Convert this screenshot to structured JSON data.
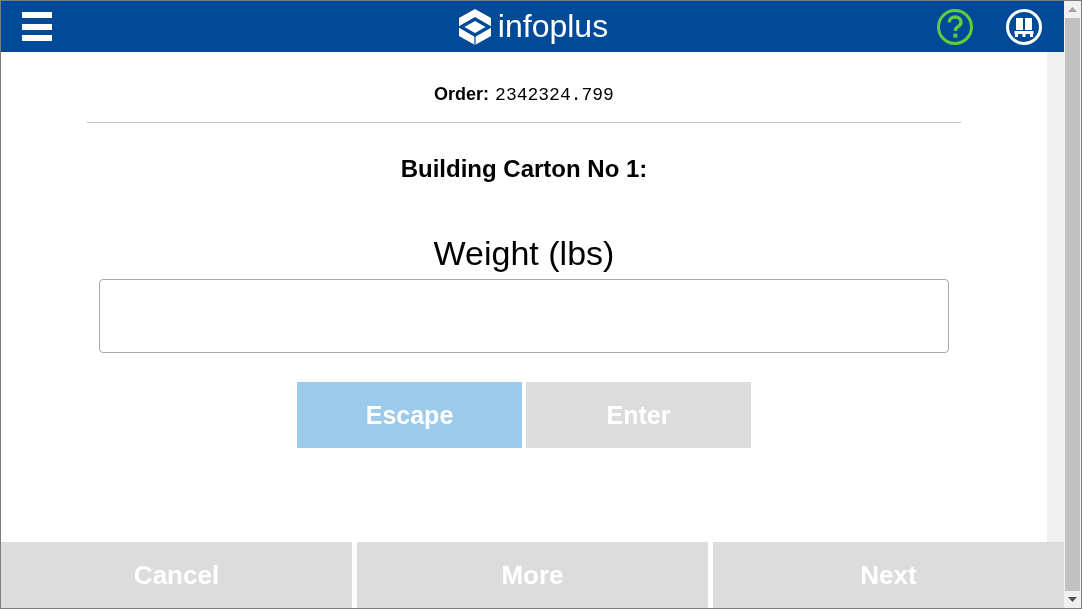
{
  "header": {
    "logo_text": "infoplus"
  },
  "order": {
    "label": "Order:",
    "number": "2342324.799"
  },
  "heading": "Building Carton No 1:",
  "weight_field": {
    "label": "Weight (lbs)"
  },
  "actions": [
    {
      "label": "Escape",
      "disabled": false
    },
    {
      "label": "Enter",
      "disabled": true
    }
  ],
  "footer_buttons": [
    {
      "label": "Cancel",
      "disabled": true
    },
    {
      "label": "More",
      "disabled": true
    },
    {
      "label": "Next",
      "disabled": true
    }
  ]
}
